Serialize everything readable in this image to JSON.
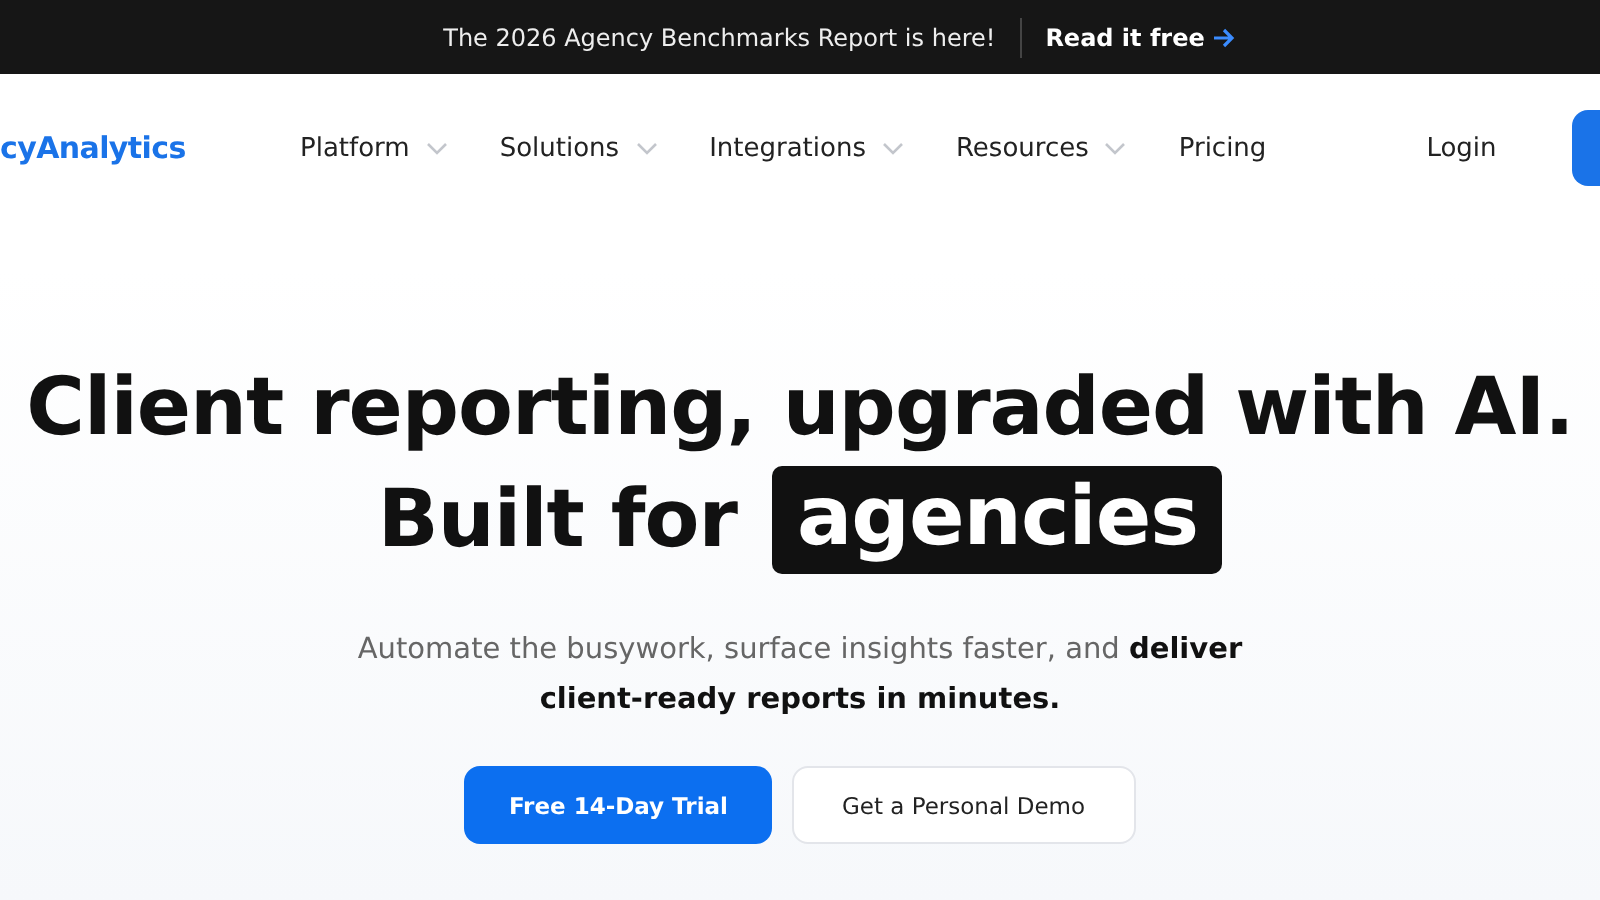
{
  "announcement": {
    "text": "The 2026 Agency Benchmarks Report is here!",
    "link": "Read it free"
  },
  "nav": {
    "logo": "cyAnalytics",
    "items": [
      {
        "label": "Platform",
        "dropdown": true
      },
      {
        "label": "Solutions",
        "dropdown": true
      },
      {
        "label": "Integrations",
        "dropdown": true
      },
      {
        "label": "Resources",
        "dropdown": true
      },
      {
        "label": "Pricing",
        "dropdown": false
      }
    ],
    "login": "Login"
  },
  "hero": {
    "headline": "Client reporting, upgraded with AI.",
    "headline_2": "Built for",
    "highlight": "agencies",
    "subtitle": "Automate the busywork, surface insights faster, and **deliver client-ready reports in minutes.**",
    "buttons": [
      {
        "label": "Free 14-Day Trial",
        "kind": "primary"
      },
      {
        "label": "Get a Personal Demo",
        "kind": "secondary"
      }
    ]
  }
}
